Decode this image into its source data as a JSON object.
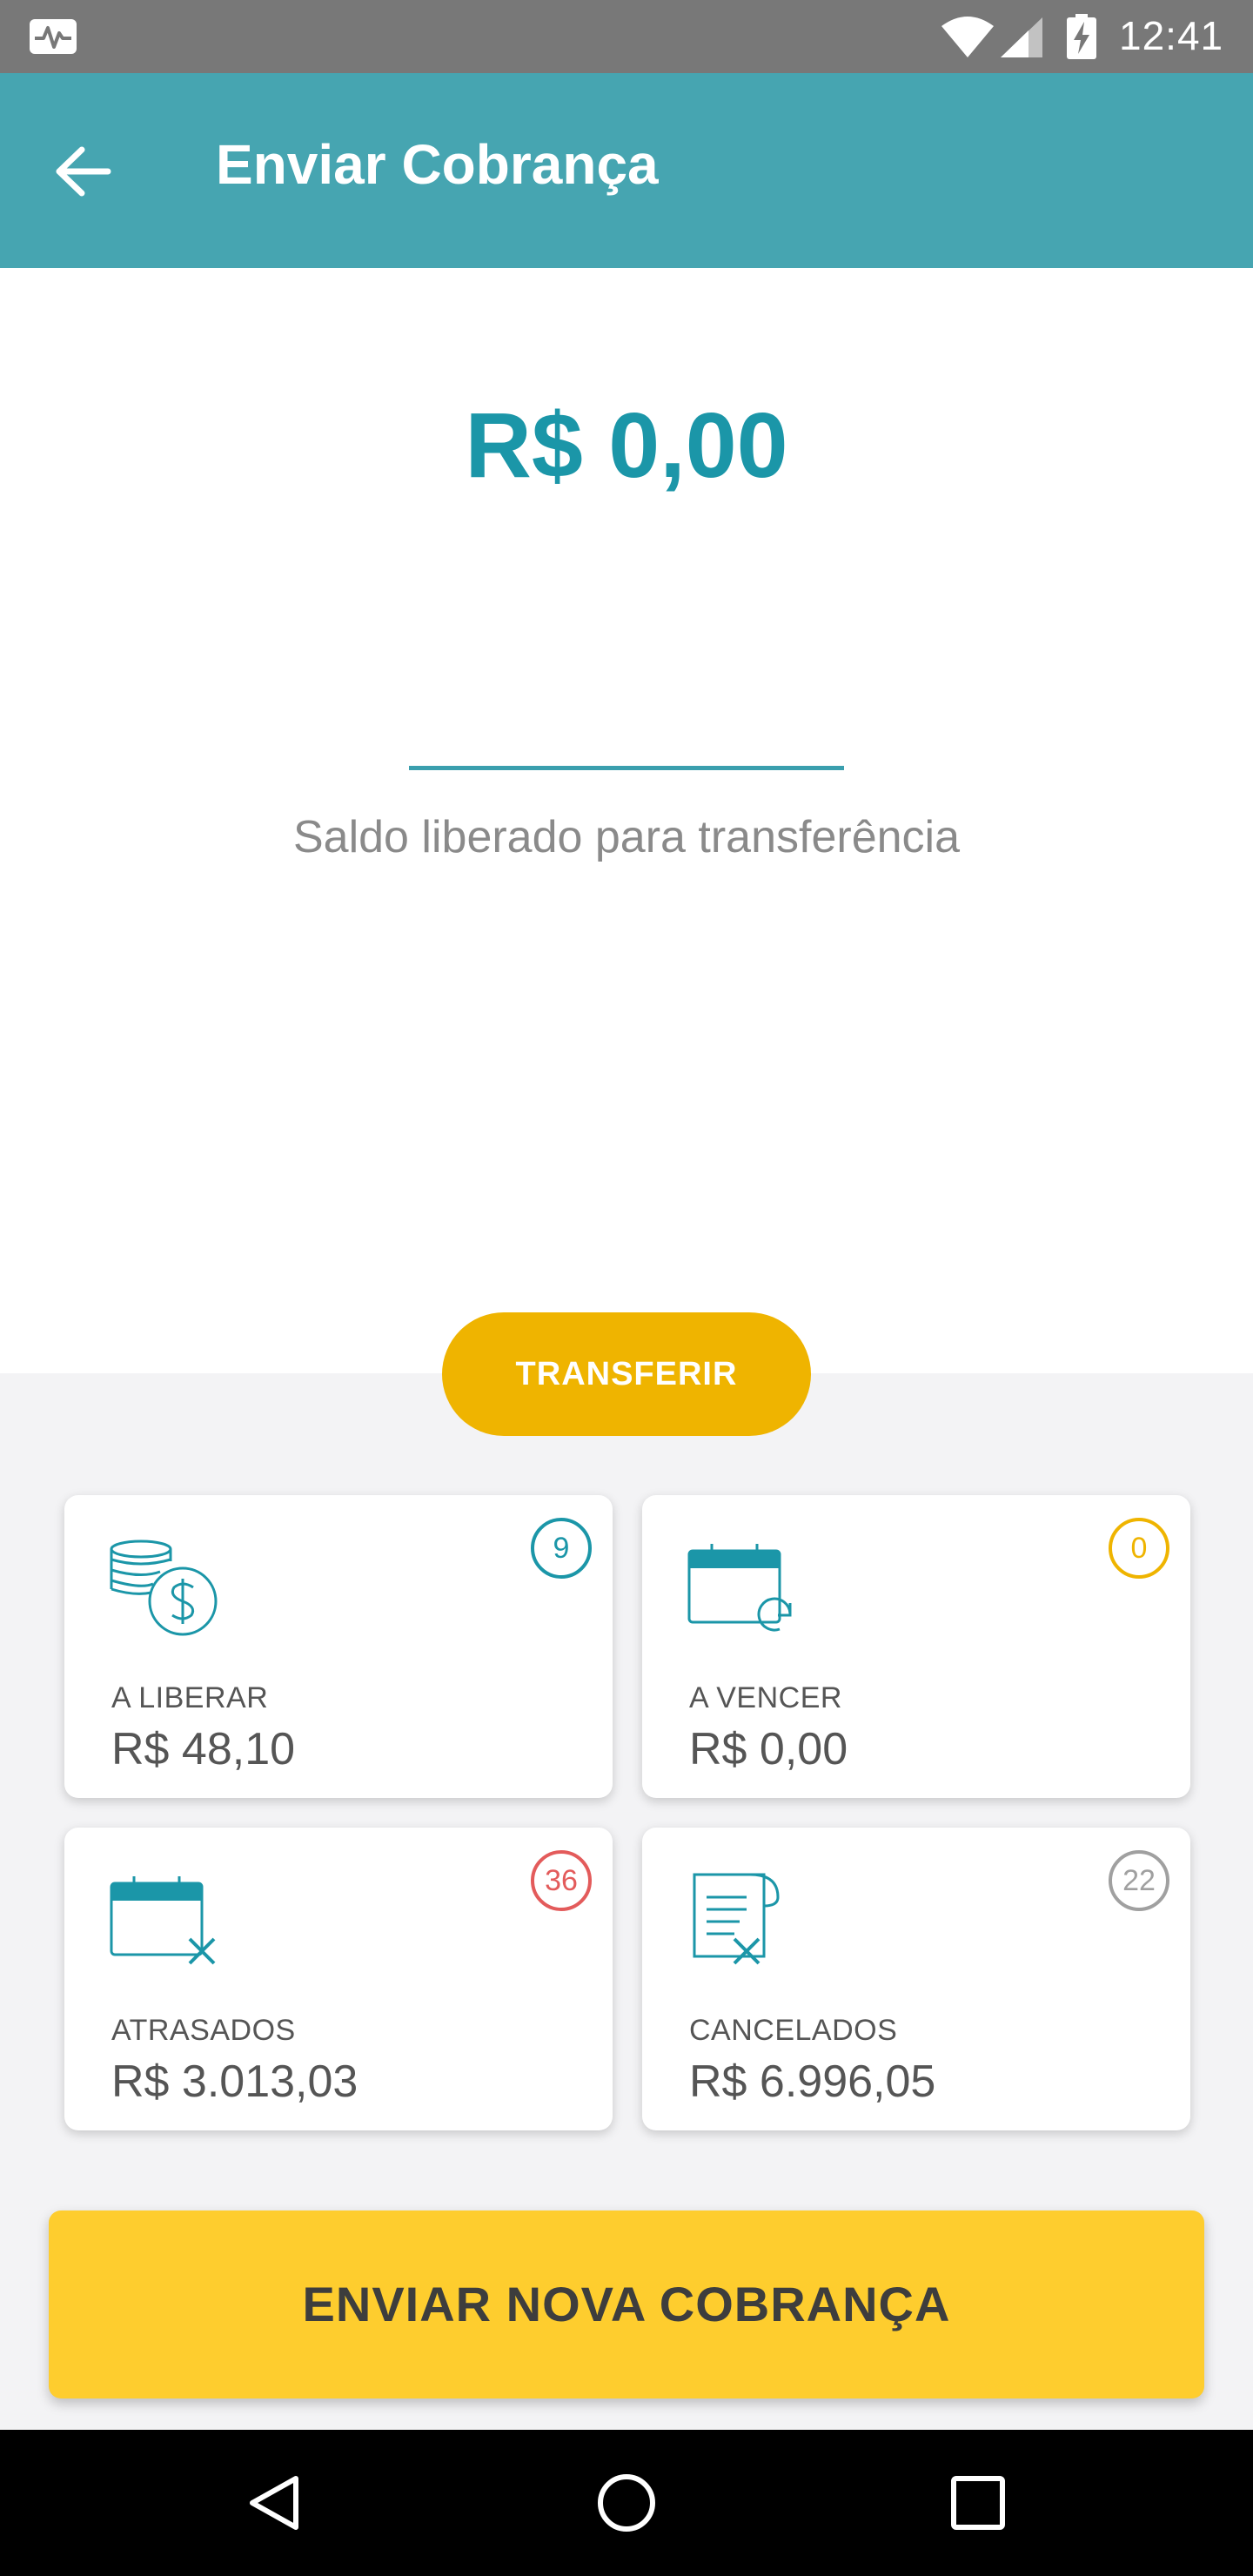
{
  "status_bar": {
    "time": "12:41",
    "icons": [
      "activity-icon",
      "wifi-icon",
      "signal-icon",
      "battery-charging-icon"
    ]
  },
  "app_bar": {
    "title": "Enviar Cobrança",
    "back_icon": "arrow-left-icon",
    "background_color": "#46a5b1"
  },
  "balance": {
    "amount": "R$ 0,00",
    "caption": "Saldo liberado para transferência",
    "amount_color": "#1b96a8"
  },
  "transfer_button": {
    "label": "TRANSFERIR",
    "color": "#efb400"
  },
  "cards": [
    {
      "label": "A LIBERAR",
      "value": "R$ 48,10",
      "count": "9",
      "badge_color": "#1b96a8",
      "icon": "coins-dollar-icon"
    },
    {
      "label": "A VENCER",
      "value": "R$ 0,00",
      "count": "0",
      "badge_color": "#efb400",
      "icon": "calendar-refresh-icon"
    },
    {
      "label": "ATRASADOS",
      "value": "R$ 3.013,03",
      "count": "36",
      "badge_color": "#e35b5b",
      "icon": "calendar-cancel-icon"
    },
    {
      "label": "CANCELADOS",
      "value": "R$ 6.996,05",
      "count": "22",
      "badge_color": "#a0a0a0",
      "icon": "document-cancel-icon"
    }
  ],
  "send_button": {
    "label": "ENVIAR NOVA COBRANÇA",
    "color": "#fecd2e"
  },
  "nav_bar": {
    "icons": [
      "nav-back-icon",
      "nav-home-icon",
      "nav-recent-icon"
    ]
  }
}
